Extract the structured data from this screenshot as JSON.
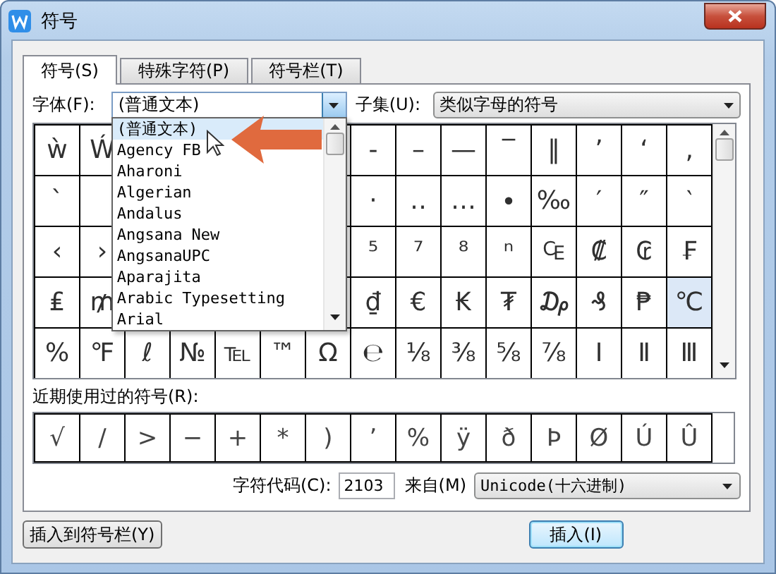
{
  "window": {
    "title": "符号"
  },
  "tabs": [
    {
      "label": "符号(S)",
      "selected": true
    },
    {
      "label": "特殊字符(P)",
      "selected": false
    },
    {
      "label": "符号栏(T)",
      "selected": false
    }
  ],
  "font": {
    "label": "字体(F):",
    "value": "(普通文本)",
    "expanded": true,
    "options": [
      {
        "label": "(普通文本)",
        "selected": true
      },
      {
        "label": "Agency FB",
        "selected": false
      },
      {
        "label": "Aharoni",
        "selected": false
      },
      {
        "label": "Algerian",
        "selected": false
      },
      {
        "label": "Andalus",
        "selected": false
      },
      {
        "label": "Angsana New",
        "selected": false
      },
      {
        "label": "AngsanaUPC",
        "selected": false
      },
      {
        "label": "Aparajita",
        "selected": false
      },
      {
        "label": "Arabic Typesetting",
        "selected": false
      },
      {
        "label": "Arial",
        "selected": false
      }
    ]
  },
  "subset": {
    "label": "子集(U):",
    "value": "类似字母的符号"
  },
  "symbols": [
    {
      "before_menu": [
        {
          "symbol": "ẁ",
          "selected": false
        },
        {
          "symbol": "Ẃ",
          "selected": false
        }
      ],
      "after_menu": [
        {
          "symbol": "‐",
          "selected": false
        },
        {
          "symbol": "–",
          "selected": false
        },
        {
          "symbol": "—",
          "selected": false
        },
        {
          "symbol": "‾",
          "selected": false
        },
        {
          "symbol": "‖",
          "selected": false
        },
        {
          "symbol": "ʼ",
          "selected": false
        },
        {
          "symbol": "ʻ",
          "selected": false
        },
        {
          "symbol": "‚",
          "selected": false
        }
      ]
    },
    {
      "before_menu": [
        {
          "symbol": "`",
          "selected": false
        }
      ],
      "after_menu": [
        {
          "symbol": "·",
          "selected": false
        },
        {
          "symbol": "‥",
          "selected": false
        },
        {
          "symbol": "…",
          "selected": false
        },
        {
          "symbol": "∙",
          "selected": false
        },
        {
          "symbol": "‰",
          "selected": false
        },
        {
          "symbol": "′",
          "selected": false
        },
        {
          "symbol": "″",
          "selected": false
        },
        {
          "symbol": "‵",
          "selected": false
        }
      ]
    },
    {
      "before_menu": [
        {
          "symbol": "‹",
          "selected": false
        },
        {
          "symbol": "›",
          "selected": false
        }
      ],
      "after_menu": [
        {
          "symbol": "⁵",
          "selected": false
        },
        {
          "symbol": "⁷",
          "selected": false
        },
        {
          "symbol": "⁸",
          "selected": false
        },
        {
          "symbol": "ⁿ",
          "selected": false
        },
        {
          "symbol": "₠",
          "selected": false
        },
        {
          "symbol": "₡",
          "selected": false
        },
        {
          "symbol": "₢",
          "selected": false
        },
        {
          "symbol": "₣",
          "selected": false
        }
      ]
    },
    {
      "before_menu": [
        {
          "symbol": "₤",
          "selected": false
        },
        {
          "symbol": "₥",
          "selected": false
        }
      ],
      "after_menu": [
        {
          "symbol": "₫",
          "selected": false
        },
        {
          "symbol": "€",
          "selected": false
        },
        {
          "symbol": "₭",
          "selected": false
        },
        {
          "symbol": "₮",
          "selected": false
        },
        {
          "symbol": "₯",
          "selected": false
        },
        {
          "symbol": "₰",
          "selected": false
        },
        {
          "symbol": "₱",
          "selected": false
        },
        {
          "symbol": "℃",
          "selected": true
        }
      ]
    },
    {
      "before_menu": [
        {
          "symbol": "%",
          "selected": false
        },
        {
          "symbol": "℉",
          "selected": false
        },
        {
          "symbol": "ℓ",
          "selected": false
        },
        {
          "symbol": "№",
          "selected": false
        },
        {
          "symbol": "℡",
          "selected": false
        },
        {
          "symbol": "™",
          "selected": false
        },
        {
          "symbol": "Ω",
          "selected": false
        },
        {
          "symbol": "℮",
          "selected": false
        },
        {
          "symbol": "⅛",
          "selected": false
        },
        {
          "symbol": "⅜",
          "selected": false
        },
        {
          "symbol": "⅝",
          "selected": false
        },
        {
          "symbol": "⅞",
          "selected": false
        },
        {
          "symbol": "Ⅰ",
          "selected": false
        },
        {
          "symbol": "Ⅱ",
          "selected": false
        },
        {
          "symbol": "Ⅲ",
          "selected": false
        }
      ]
    }
  ],
  "recent": {
    "label": "近期使用过的符号(R):",
    "symbols": [
      "√",
      "/",
      ">",
      "−",
      "+",
      "*",
      ")",
      "’",
      "%",
      "ÿ",
      "ð",
      "Þ",
      "Ø",
      "Ú",
      "Û"
    ]
  },
  "code": {
    "label": "字符代码(C):",
    "value": "2103",
    "from_label": "来自(M)",
    "from_value": "Unicode(十六进制)"
  },
  "buttons": [
    {
      "label": "插入到符号栏(Y)",
      "focused": false
    },
    {
      "label": "插入(I)",
      "focused": true
    }
  ]
}
